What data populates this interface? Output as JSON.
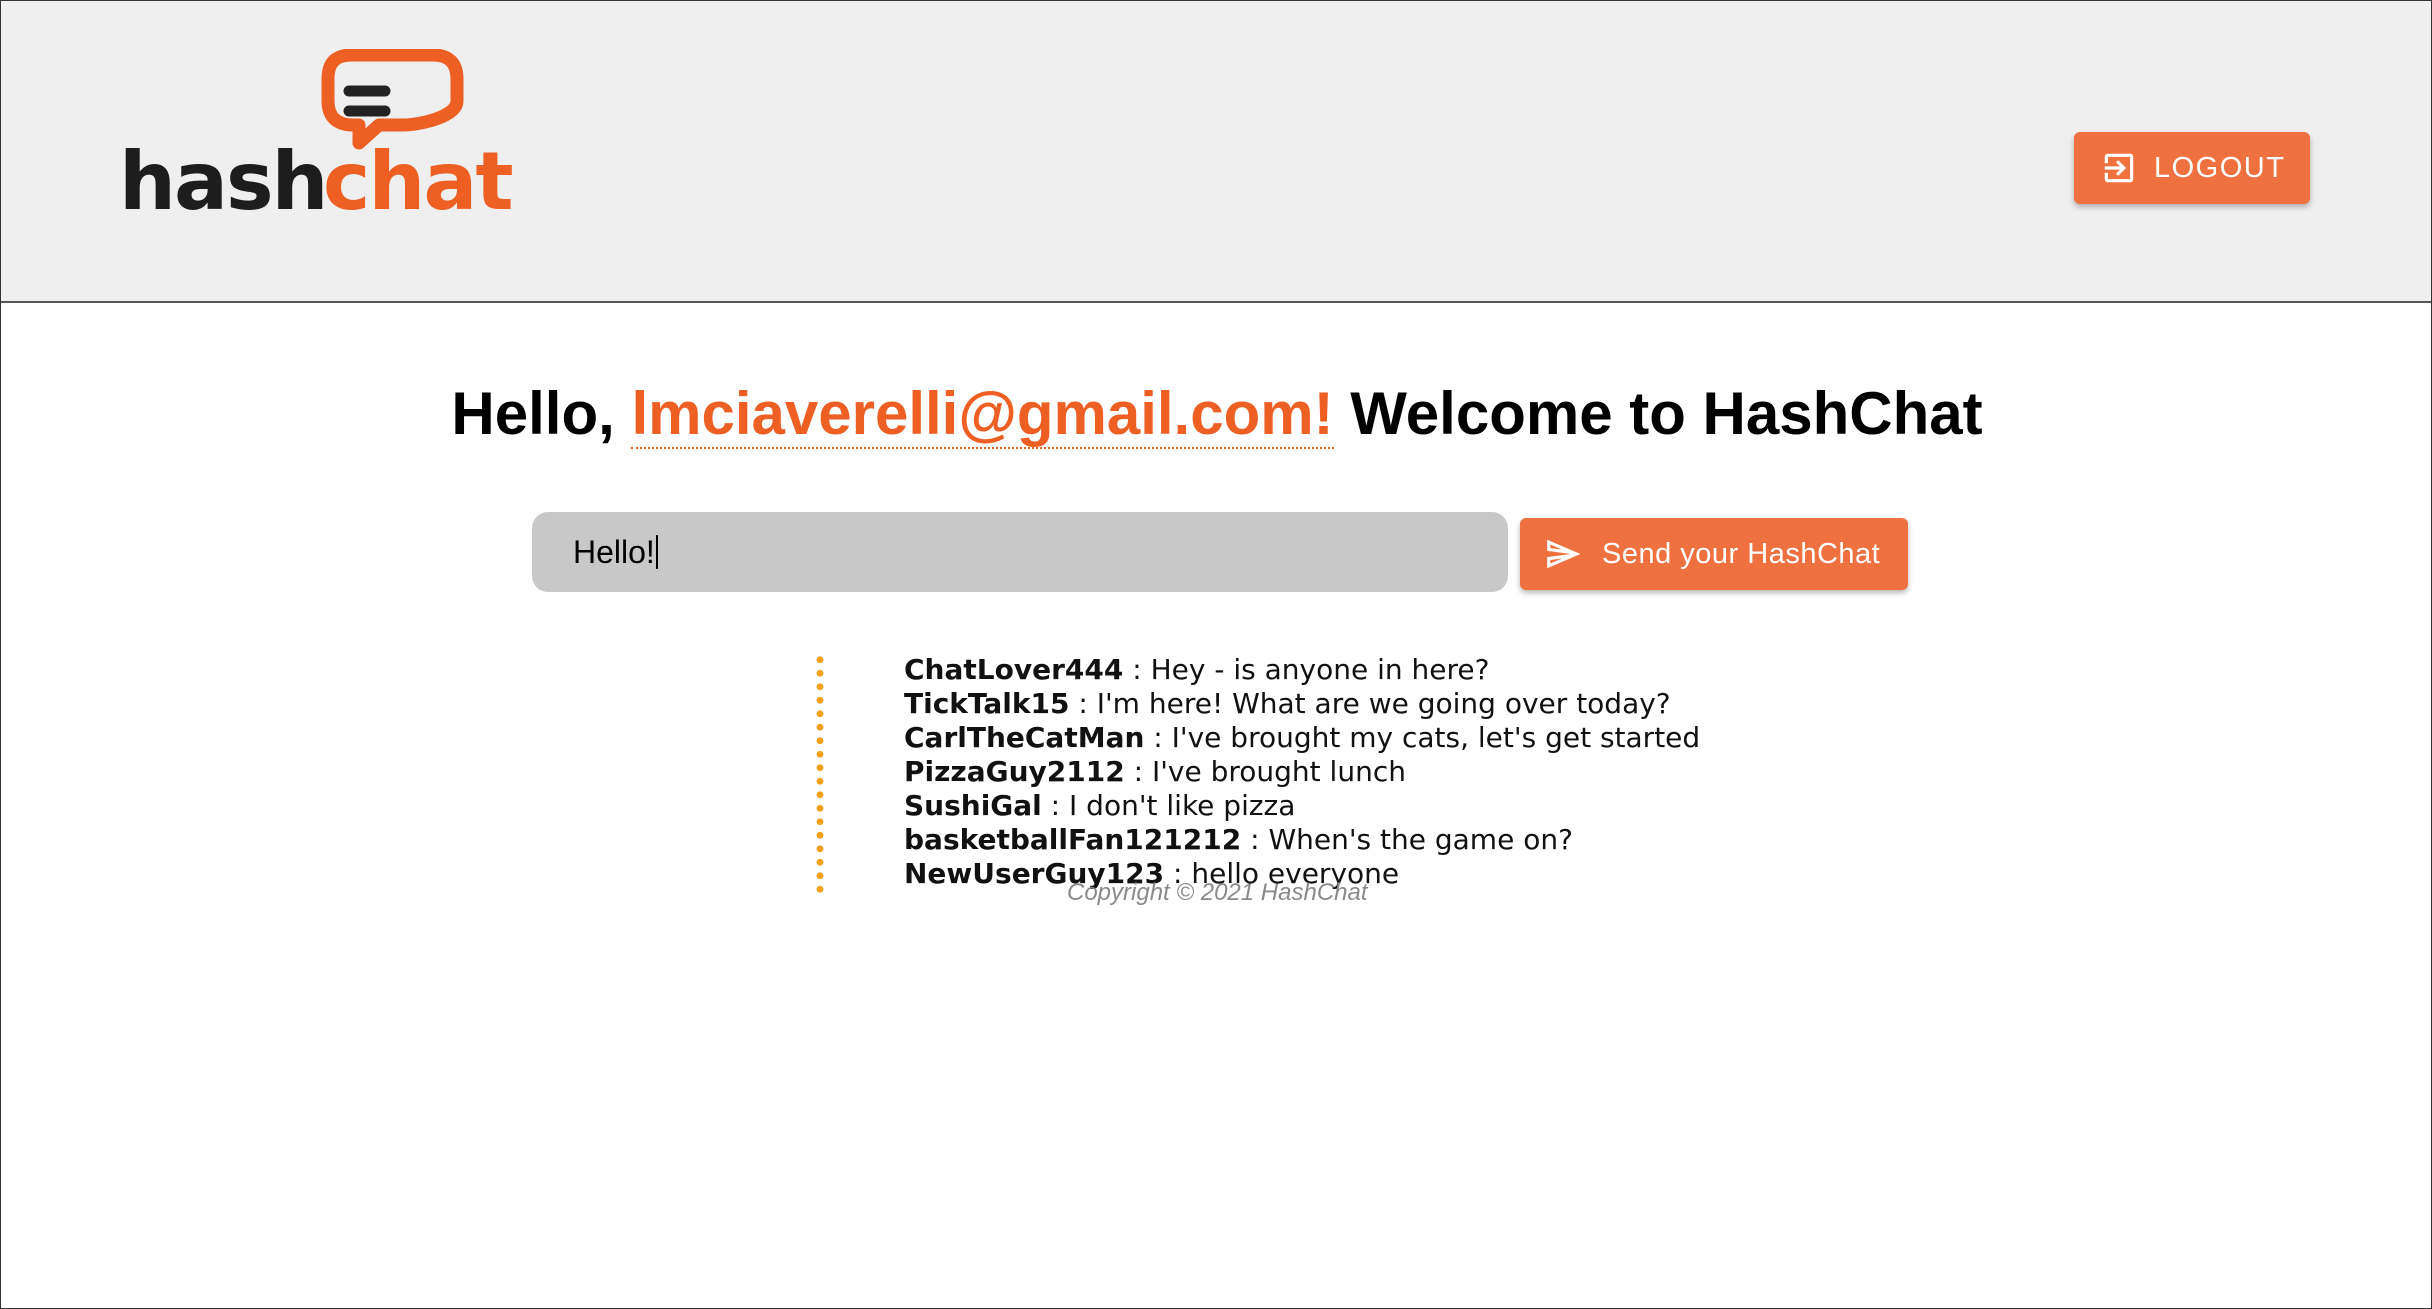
{
  "app": {
    "logo_text_dark": "hash",
    "logo_text_accent": "chat",
    "brand_color": "#ee5f24",
    "button_color": "#ee713f"
  },
  "header": {
    "logout_label": "LOGOUT",
    "logout_icon": "exit-to-app-icon"
  },
  "greeting": {
    "prefix": "Hello,",
    "email": "lmciaverelli@gmail.com!",
    "suffix": "Welcome to HashChat"
  },
  "composer": {
    "input_value": "Hello!",
    "send_label": "Send your HashChat",
    "send_icon": "send-icon"
  },
  "messages": [
    {
      "user": "ChatLover444",
      "text": " : Hey - is anyone in here?"
    },
    {
      "user": "TickTalk15",
      "text": " : I'm here! What are we going over today?"
    },
    {
      "user": "CarlTheCatMan",
      "text": " : I've brought my cats, let's get started"
    },
    {
      "user": "PizzaGuy2112",
      "text": " : I've brought lunch"
    },
    {
      "user": "SushiGal",
      "text": " : I don't like pizza"
    },
    {
      "user": "basketballFan121212",
      "text": " : When's the game on?"
    },
    {
      "user": "NewUserGuy123",
      "text": " : hello everyone"
    }
  ],
  "footer": {
    "copyright": "Copyright © 2021 HashChat"
  }
}
